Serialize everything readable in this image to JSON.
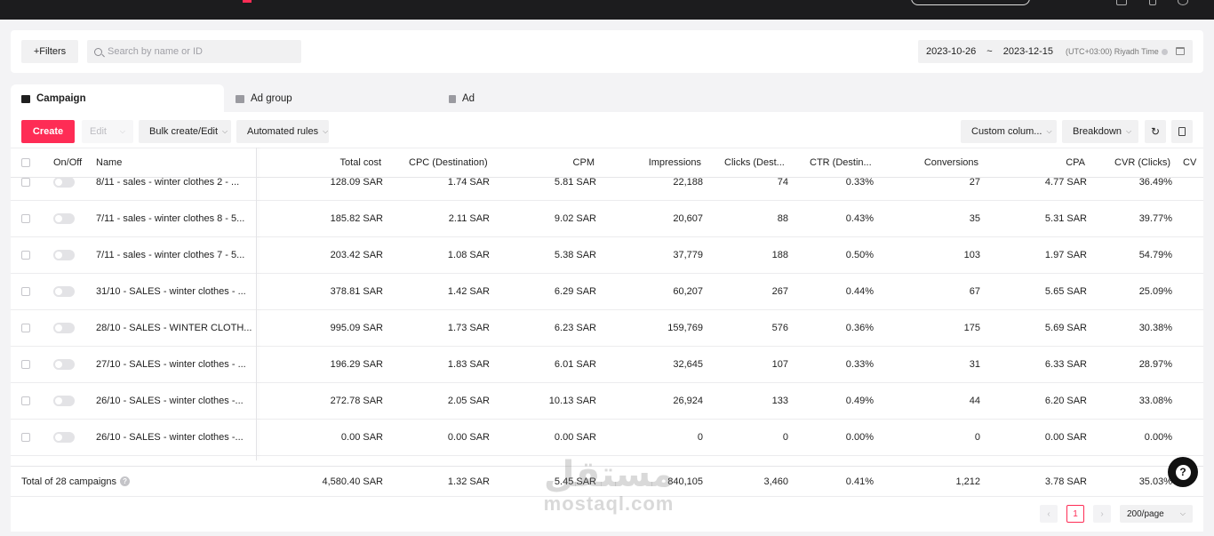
{
  "filters": {
    "label": "+Filters",
    "search_placeholder": "Search by name or ID"
  },
  "date_range": {
    "start": "2023-10-26",
    "sep": "~",
    "end": "2023-12-15",
    "timezone": "(UTC+03:00) Riyadh Time"
  },
  "tabs": [
    {
      "label": "Campaign",
      "active": true
    },
    {
      "label": "Ad group",
      "active": false
    },
    {
      "label": "Ad",
      "active": false
    }
  ],
  "toolbar": {
    "create": "Create",
    "edit": "Edit",
    "bulk": "Bulk create/Edit",
    "automated": "Automated rules",
    "custom_columns": "Custom colum...",
    "breakdown": "Breakdown"
  },
  "columns": {
    "onoff": "On/Off",
    "name": "Name",
    "total_cost": "Total cost",
    "cpc": "CPC (Destination)",
    "cpm": "CPM",
    "impressions": "Impressions",
    "clicks": "Clicks (Dest...",
    "ctr": "CTR (Destin...",
    "conversions": "Conversions",
    "cpa": "CPA",
    "cvr": "CVR (Clicks)",
    "next": "CV"
  },
  "rows": [
    {
      "name": "8/11 - sales - winter clothes 2 - ...",
      "total_cost": "128.09 SAR",
      "cpc": "1.74 SAR",
      "cpm": "5.81 SAR",
      "impressions": "22,188",
      "clicks": "74",
      "ctr": "0.33%",
      "conversions": "27",
      "cpa": "4.77 SAR",
      "cvr": "36.49%"
    },
    {
      "name": "7/11 - sales - winter clothes 8 - 5...",
      "total_cost": "185.82 SAR",
      "cpc": "2.11 SAR",
      "cpm": "9.02 SAR",
      "impressions": "20,607",
      "clicks": "88",
      "ctr": "0.43%",
      "conversions": "35",
      "cpa": "5.31 SAR",
      "cvr": "39.77%"
    },
    {
      "name": "7/11 - sales - winter clothes 7 - 5...",
      "total_cost": "203.42 SAR",
      "cpc": "1.08 SAR",
      "cpm": "5.38 SAR",
      "impressions": "37,779",
      "clicks": "188",
      "ctr": "0.50%",
      "conversions": "103",
      "cpa": "1.97 SAR",
      "cvr": "54.79%"
    },
    {
      "name": "31/10 - SALES - winter clothes - ...",
      "total_cost": "378.81 SAR",
      "cpc": "1.42 SAR",
      "cpm": "6.29 SAR",
      "impressions": "60,207",
      "clicks": "267",
      "ctr": "0.44%",
      "conversions": "67",
      "cpa": "5.65 SAR",
      "cvr": "25.09%"
    },
    {
      "name": "28/10 - SALES - WINTER CLOTH...",
      "total_cost": "995.09 SAR",
      "cpc": "1.73 SAR",
      "cpm": "6.23 SAR",
      "impressions": "159,769",
      "clicks": "576",
      "ctr": "0.36%",
      "conversions": "175",
      "cpa": "5.69 SAR",
      "cvr": "30.38%"
    },
    {
      "name": "27/10 - SALES - winter clothes - ...",
      "total_cost": "196.29 SAR",
      "cpc": "1.83 SAR",
      "cpm": "6.01 SAR",
      "impressions": "32,645",
      "clicks": "107",
      "ctr": "0.33%",
      "conversions": "31",
      "cpa": "6.33 SAR",
      "cvr": "28.97%"
    },
    {
      "name": "26/10 - SALES - winter clothes -...",
      "total_cost": "272.78 SAR",
      "cpc": "2.05 SAR",
      "cpm": "10.13 SAR",
      "impressions": "26,924",
      "clicks": "133",
      "ctr": "0.49%",
      "conversions": "44",
      "cpa": "6.20 SAR",
      "cvr": "33.08%"
    },
    {
      "name": "26/10 - SALES - winter clothes -...",
      "total_cost": "0.00 SAR",
      "cpc": "0.00 SAR",
      "cpm": "0.00 SAR",
      "impressions": "0",
      "clicks": "0",
      "ctr": "0.00%",
      "conversions": "0",
      "cpa": "0.00 SAR",
      "cvr": "0.00%"
    }
  ],
  "total": {
    "label": "Total of 28 campaigns",
    "total_cost": "4,580.40 SAR",
    "cpc": "1.32 SAR",
    "cpm": "5.45 SAR",
    "impressions": "840,105",
    "clicks": "3,460",
    "ctr": "0.41%",
    "conversions": "1,212",
    "cpa": "3.78 SAR",
    "cvr": "35.03%"
  },
  "pagination": {
    "prev": "‹",
    "current": "1",
    "next": "›",
    "page_size": "200/page"
  },
  "watermark": {
    "arabic": "مستقل",
    "latin": "mostaql.com"
  },
  "colors": {
    "accent": "#fe2c55",
    "topbar": "#1c1c1e"
  }
}
